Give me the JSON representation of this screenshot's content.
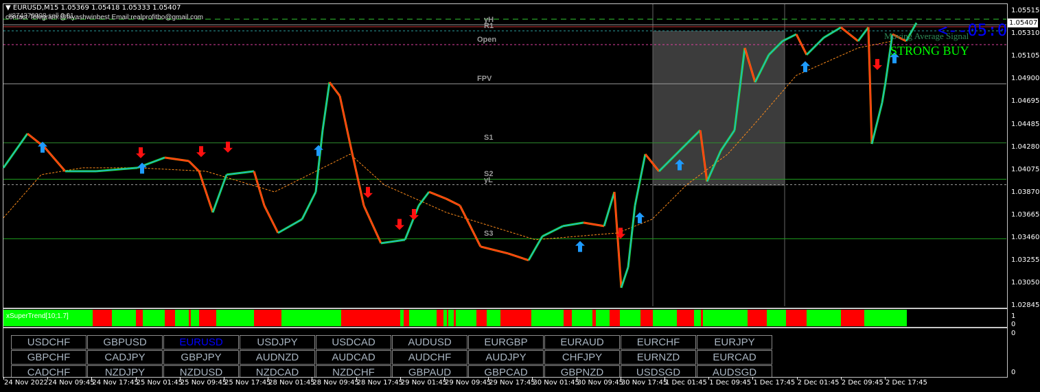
{
  "header": {
    "symbol_line": "EURUSD,M15  1.05369 1.05418 1.05333 1.05407",
    "order_line": "#874379998 sell 0.01",
    "contact_line": "contact Telegram:@fxyashwinbest Email:realprofitbo@gmail.com"
  },
  "levels": [
    {
      "label": "yH",
      "price": 1.0539,
      "color": "#9a9a9a",
      "style": "solid"
    },
    {
      "label": "R1",
      "price": 1.05335,
      "color": "#2aa0a0",
      "style": "dashed"
    },
    {
      "label": "Open",
      "price": 1.0521,
      "color": "#e040a0",
      "style": "dashed"
    },
    {
      "label": "FPV",
      "price": 1.04855,
      "color": "#9a9a9a",
      "style": "solid"
    },
    {
      "label": "S1",
      "price": 1.0432,
      "color": "#2e8b2e",
      "style": "solid"
    },
    {
      "label": "S2",
      "price": 1.0399,
      "color": "#1e9e1e",
      "style": "solid"
    },
    {
      "label": "yL",
      "price": 1.0394,
      "color": "#9a9a9a",
      "style": "dashed"
    },
    {
      "label": "S3",
      "price": 1.0345,
      "color": "#1e9e1e",
      "style": "solid"
    }
  ],
  "signal": {
    "title": "Moving Average Signal",
    "value": "STRONG BUY",
    "timer": "<--05:0"
  },
  "price_axis": {
    "ticks": [
      "1.05515",
      "1.05310",
      "1.05105",
      "1.04900",
      "1.04695",
      "1.04485",
      "1.04280",
      "1.04075",
      "1.03870",
      "1.03665",
      "1.03460",
      "1.03255",
      "1.03050",
      "1.02845"
    ],
    "current": "1.05407"
  },
  "chart_data": {
    "type": "line",
    "ylim": [
      1.02845,
      1.05515
    ],
    "price": [
      [
        5,
        1.04093
      ],
      [
        40,
        1.04403
      ],
      [
        65,
        1.04279
      ],
      [
        95,
        1.04062
      ],
      [
        140,
        1.04062
      ],
      [
        200,
        1.04093
      ],
      [
        240,
        1.04186
      ],
      [
        275,
        1.04155
      ],
      [
        290,
        1.04062
      ],
      [
        310,
        1.03689
      ],
      [
        330,
        1.04031
      ],
      [
        370,
        1.04062
      ],
      [
        385,
        1.03751
      ],
      [
        405,
        1.03503
      ],
      [
        440,
        1.03627
      ],
      [
        460,
        1.03875
      ],
      [
        470,
        1.04434
      ],
      [
        480,
        1.04869
      ],
      [
        495,
        1.04745
      ],
      [
        510,
        1.0431
      ],
      [
        530,
        1.03751
      ],
      [
        555,
        1.0341
      ],
      [
        590,
        1.03441
      ],
      [
        610,
        1.03751
      ],
      [
        625,
        1.03875
      ],
      [
        650,
        1.03813
      ],
      [
        670,
        1.03751
      ],
      [
        700,
        1.03379
      ],
      [
        740,
        1.03317
      ],
      [
        770,
        1.03255
      ],
      [
        790,
        1.03472
      ],
      [
        820,
        1.03565
      ],
      [
        850,
        1.03596
      ],
      [
        880,
        1.03565
      ],
      [
        895,
        1.03875
      ],
      [
        905,
        1.03006
      ],
      [
        915,
        1.03192
      ],
      [
        925,
        1.03751
      ],
      [
        940,
        1.04217
      ],
      [
        960,
        1.04062
      ],
      [
        990,
        1.04248
      ],
      [
        1020,
        1.04434
      ],
      [
        1030,
        1.03969
      ],
      [
        1050,
        1.04248
      ],
      [
        1070,
        1.04434
      ],
      [
        1085,
        1.0518
      ],
      [
        1100,
        1.04869
      ],
      [
        1120,
        1.05118
      ],
      [
        1140,
        1.05242
      ],
      [
        1160,
        1.05304
      ],
      [
        1175,
        1.05118
      ],
      [
        1200,
        1.05273
      ],
      [
        1225,
        1.05366
      ],
      [
        1250,
        1.05242
      ],
      [
        1265,
        1.05366
      ],
      [
        1270,
        1.0431
      ],
      [
        1285,
        1.04683
      ],
      [
        1290,
        1.04869
      ],
      [
        1300,
        1.05304
      ],
      [
        1320,
        1.05242
      ],
      [
        1335,
        1.05407
      ]
    ],
    "ma": [
      [
        5,
        1.0364
      ],
      [
        60,
        1.04031
      ],
      [
        120,
        1.04093
      ],
      [
        200,
        1.04093
      ],
      [
        300,
        1.04062
      ],
      [
        400,
        1.03875
      ],
      [
        510,
        1.04217
      ],
      [
        560,
        1.03938
      ],
      [
        650,
        1.03689
      ],
      [
        780,
        1.03441
      ],
      [
        900,
        1.03503
      ],
      [
        950,
        1.03627
      ],
      [
        1000,
        1.03938
      ],
      [
        1060,
        1.04217
      ],
      [
        1100,
        1.04497
      ],
      [
        1160,
        1.04931
      ],
      [
        1250,
        1.0518
      ],
      [
        1300,
        1.05242
      ]
    ],
    "buy_arrows": [
      [
        62,
        1.0428
      ],
      [
        207,
        1.0409
      ],
      [
        464,
        1.0425
      ],
      [
        845,
        1.0338
      ],
      [
        932,
        1.0364
      ],
      [
        990,
        1.0412
      ],
      [
        1173,
        1.0501
      ],
      [
        1303,
        1.0509
      ]
    ],
    "sell_arrows": [
      [
        205,
        1.0423
      ],
      [
        293,
        1.0424
      ],
      [
        332,
        1.0428
      ],
      [
        536,
        1.0387
      ],
      [
        582,
        1.0358
      ],
      [
        603,
        1.0367
      ],
      [
        904,
        1.035
      ],
      [
        1278,
        1.0503
      ]
    ]
  },
  "supertrend": {
    "label": "xSuperTrend[10;1.7]",
    "scale": [
      "1",
      "0"
    ],
    "segments": [
      [
        1,
        130
      ],
      [
        0,
        28
      ],
      [
        1,
        35
      ],
      [
        0,
        10
      ],
      [
        1,
        32
      ],
      [
        0,
        15
      ],
      [
        1,
        20
      ],
      [
        0,
        3
      ],
      [
        1,
        12
      ],
      [
        0,
        25
      ],
      [
        1,
        55
      ],
      [
        0,
        40
      ],
      [
        1,
        87
      ],
      [
        0,
        86
      ],
      [
        1,
        5
      ],
      [
        0,
        8
      ],
      [
        1,
        40
      ],
      [
        0,
        10
      ],
      [
        1,
        5
      ],
      [
        0,
        2
      ],
      [
        1,
        8
      ],
      [
        0,
        3
      ],
      [
        1,
        30
      ],
      [
        0,
        15
      ],
      [
        1,
        20
      ],
      [
        0,
        45
      ],
      [
        1,
        47
      ],
      [
        0,
        12
      ],
      [
        1,
        30
      ],
      [
        0,
        5
      ],
      [
        1,
        20
      ],
      [
        0,
        15
      ],
      [
        1,
        30
      ],
      [
        0,
        18
      ],
      [
        1,
        35
      ],
      [
        0,
        25
      ],
      [
        1,
        10
      ],
      [
        0,
        3
      ],
      [
        1,
        65
      ],
      [
        0,
        28
      ],
      [
        1,
        28
      ],
      [
        0,
        30
      ],
      [
        1,
        50
      ],
      [
        0,
        34
      ],
      [
        1,
        62
      ]
    ]
  },
  "pairs_panel": {
    "scale": [
      "0",
      "0"
    ],
    "pairs": [
      "USDCHF",
      "GBPUSD",
      "EURUSD",
      "USDJPY",
      "USDCAD",
      "AUDUSD",
      "EURGBP",
      "EURAUD",
      "EURCHF",
      "EURJPY",
      "GBPCHF",
      "CADJPY",
      "GBPJPY",
      "AUDNZD",
      "AUDCAD",
      "AUDCHF",
      "AUDJPY",
      "CHFJPY",
      "EURNZD",
      "EURCAD",
      "CADCHF",
      "NZDJPY",
      "NZDUSD",
      "NZDCAD",
      "NZDCHF",
      "GBPAUD",
      "GBPCAD",
      "GBPNZD",
      "USDSGD",
      "AUDSGD"
    ],
    "active": "EURUSD",
    "active_color": "#0000ff"
  },
  "time_axis": [
    "24 Nov 2022",
    "24 Nov 09:45",
    "24 Nov 17:45",
    "25 Nov 01:45",
    "25 Nov 09:45",
    "25 Nov 17:45",
    "28 Nov 01:45",
    "28 Nov 09:45",
    "28 Nov 17:45",
    "29 Nov 01:45",
    "29 Nov 09:45",
    "29 Nov 17:45",
    "30 Nov 01:45",
    "30 Nov 09:45",
    "30 Nov 17:45",
    "1 Dec 01:45",
    "1 Dec 09:45",
    "1 Dec 17:45",
    "2 Dec 01:45",
    "2 Dec 09:45",
    "2 Dec 17:45"
  ]
}
